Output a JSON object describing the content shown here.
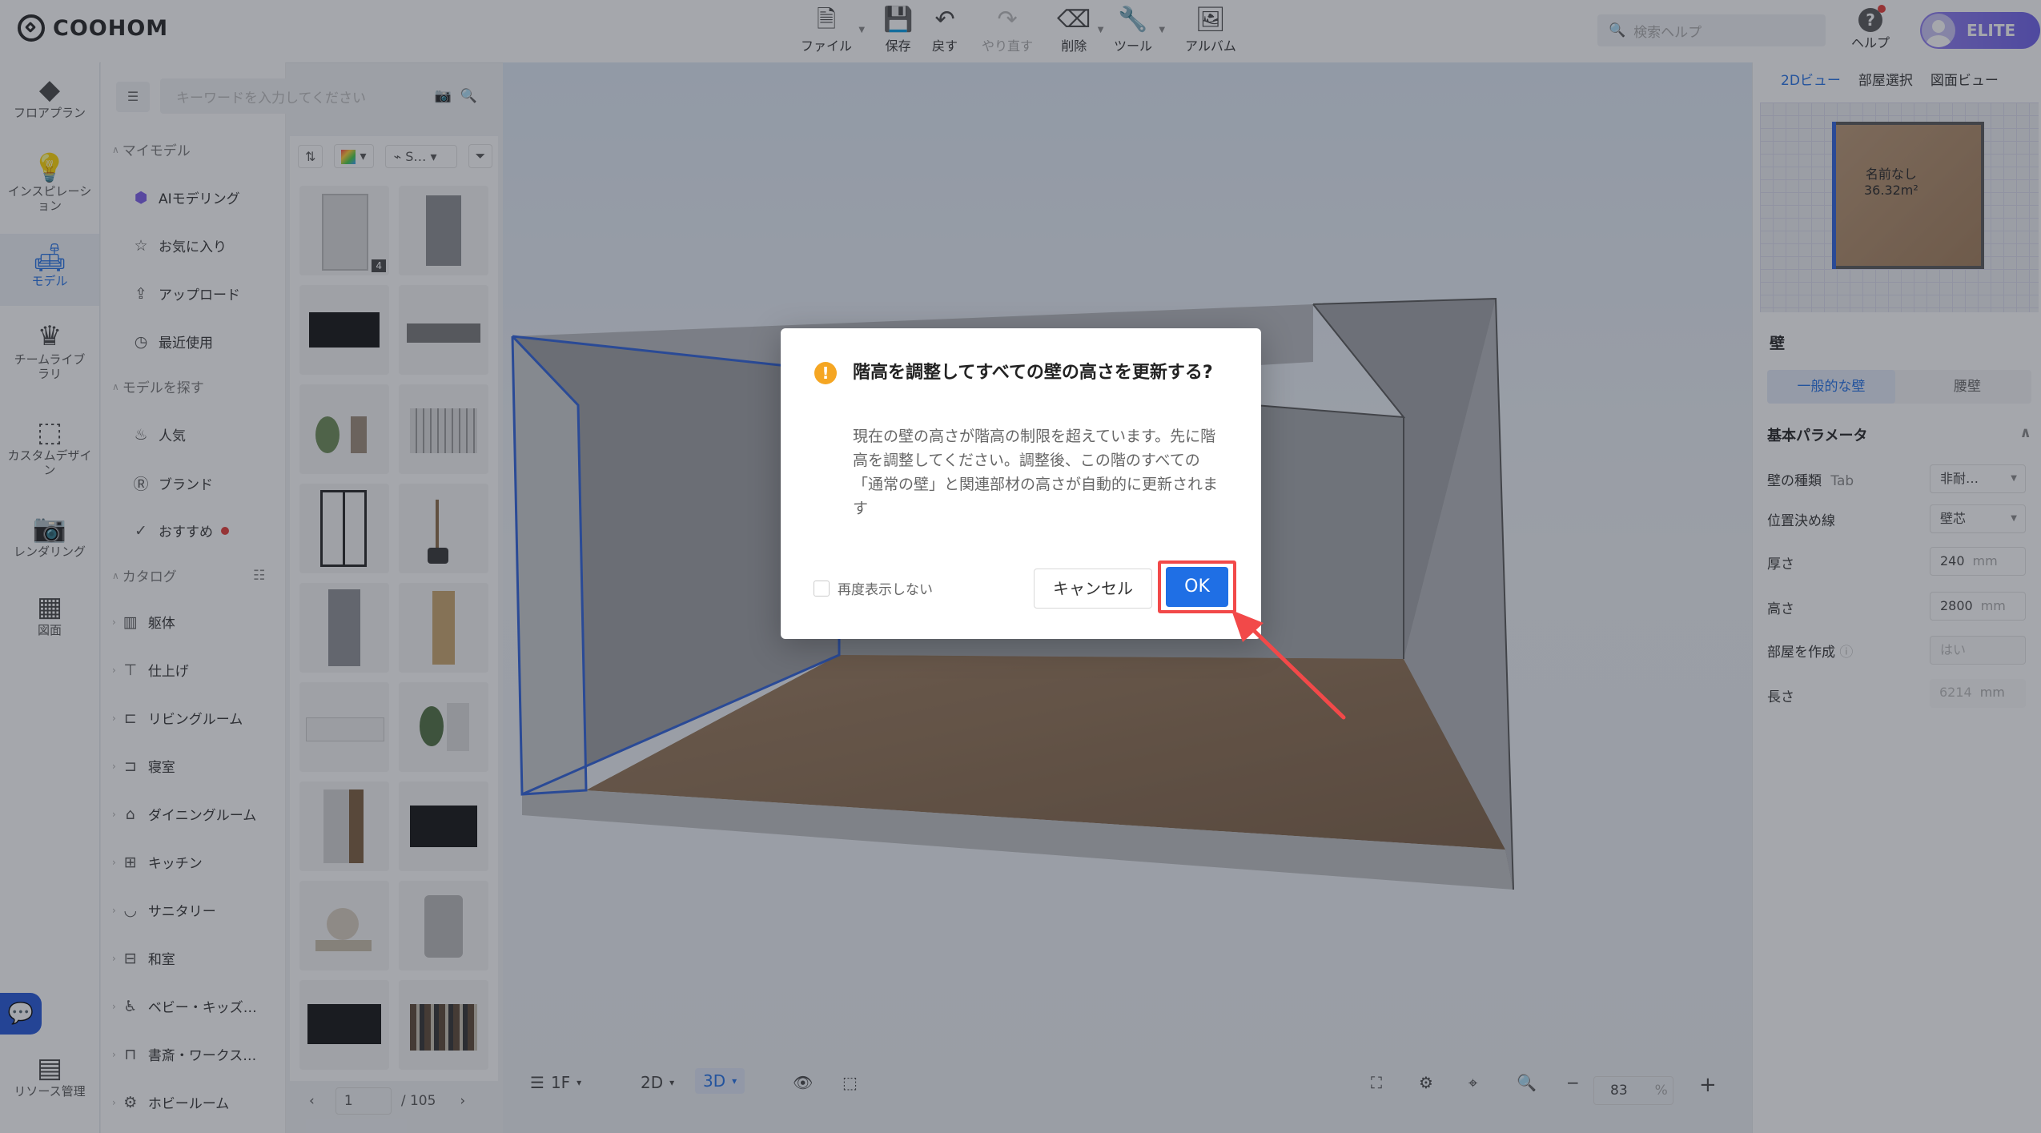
{
  "app": {
    "logo_text": "COOHOM"
  },
  "toolbar": {
    "file": "ファイル",
    "save": "保存",
    "undo": "戻す",
    "redo": "やり直す",
    "delete": "削除",
    "tools": "ツール",
    "album": "アルバム",
    "search_placeholder": "検索ヘルプ",
    "help": "ヘルプ",
    "plan_badge": "ELITE"
  },
  "rail": {
    "floorplan": "フロアプラン",
    "inspiration": "インスピレーション",
    "model": "モデル",
    "team_library": "チームライブラリ",
    "custom_design": "カスタムデザイン",
    "rendering": "レンダリング",
    "drawing": "図面",
    "resources": "リソース管理"
  },
  "catalog": {
    "search_placeholder": "キーワードを入力してください",
    "my_models": "マイモデル",
    "ai_modeling": "AIモデリング",
    "favorites": "お気に入り",
    "upload": "アップロード",
    "recent": "最近使用",
    "find_models": "モデルを探す",
    "popular": "人気",
    "brand": "ブランド",
    "recommended": "おすすめ",
    "catalog": "カタログ",
    "structure": "躯体",
    "finish": "仕上げ",
    "living": "リビングルーム",
    "bedroom": "寝室",
    "dining": "ダイニングルーム",
    "kitchen": "キッチン",
    "sanitary": "サニタリー",
    "japanese_room": "和室",
    "baby_kids": "ベビー・キッズ…",
    "study": "書斎・ワークス…",
    "hobby": "ホビールーム",
    "sort_label": "S…",
    "page_current": "1",
    "page_total": "/ 105",
    "thumb_badge": "4"
  },
  "rightpanel": {
    "tab_2d": "2Dビュー",
    "tab_room": "部屋選択",
    "tab_drawing": "図面ビュー",
    "room_name": "名前なし",
    "room_area": "36.32m²",
    "section_title": "壁",
    "subtab_general": "一般的な壁",
    "subtab_waist": "腰壁",
    "basic_params": "基本パラメータ",
    "wall_type_label": "壁の種類",
    "wall_type_tag": "Tab",
    "wall_type_value": "非耐…",
    "position_label": "位置決め線",
    "position_value": "壁芯",
    "thickness_label": "厚さ",
    "thickness_value": "240",
    "height_label": "高さ",
    "height_value": "2800",
    "create_room_label": "部屋を作成",
    "create_room_value": "はい",
    "length_label": "長さ",
    "length_value": "6214",
    "unit": "mm"
  },
  "bottombar": {
    "floor": "1F",
    "view_2d": "2D",
    "view_3d": "3D",
    "zoom": "83",
    "zoom_unit": "%"
  },
  "dialog": {
    "title": "階高を調整してすべての壁の高さを更新する?",
    "body": "現在の壁の高さが階高の制限を超えています。先に階高を調整してください。調整後、この階のすべての「通常の壁」と関連部材の高さが自動的に更新されます",
    "dont_show": "再度表示しない",
    "cancel": "キャンセル",
    "ok": "OK"
  },
  "colors": {
    "accent": "#1f6fe5",
    "highlight": "#f24949",
    "warning": "#f5a623"
  }
}
